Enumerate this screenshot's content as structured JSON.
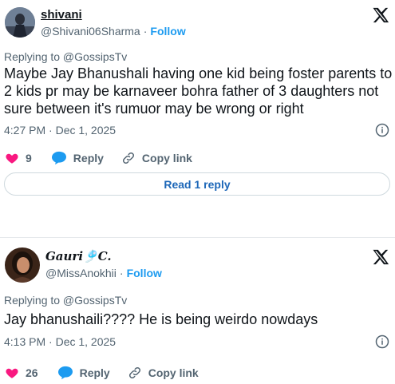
{
  "tweets": [
    {
      "name": "shivani",
      "handle": "@Shivani06Sharma",
      "follow": "Follow",
      "replying": "Replying to @GossipsTv",
      "text": "Maybe Jay Bhanushali having one kid being foster parents to 2 kids pr may be karnaveer bohra father of 3 daughters not sure between it's rumuor may be wrong or right",
      "time": "4:27 PM · Dec 1, 2025",
      "likes": "9",
      "reply": "Reply",
      "copy": "Copy link",
      "read_more": "Read 1 reply"
    },
    {
      "name": "Gauri🎐C.",
      "handle": "@MissAnokhii",
      "follow": "Follow",
      "replying": "Replying to @GossipsTv",
      "text": "Jay bhanushaili???? He is being weirdo nowdays",
      "time": "4:13 PM · Dec 1, 2025",
      "likes": "26",
      "reply": "Reply",
      "copy": "Copy link"
    }
  ],
  "colors": {
    "like": "#f91880",
    "reply": "#1d9bf0",
    "link": "#1d9bf0",
    "muted": "#536471"
  },
  "icons": [
    "x-logo-icon",
    "info-icon",
    "heart-icon",
    "reply-bubble-icon",
    "link-icon"
  ]
}
